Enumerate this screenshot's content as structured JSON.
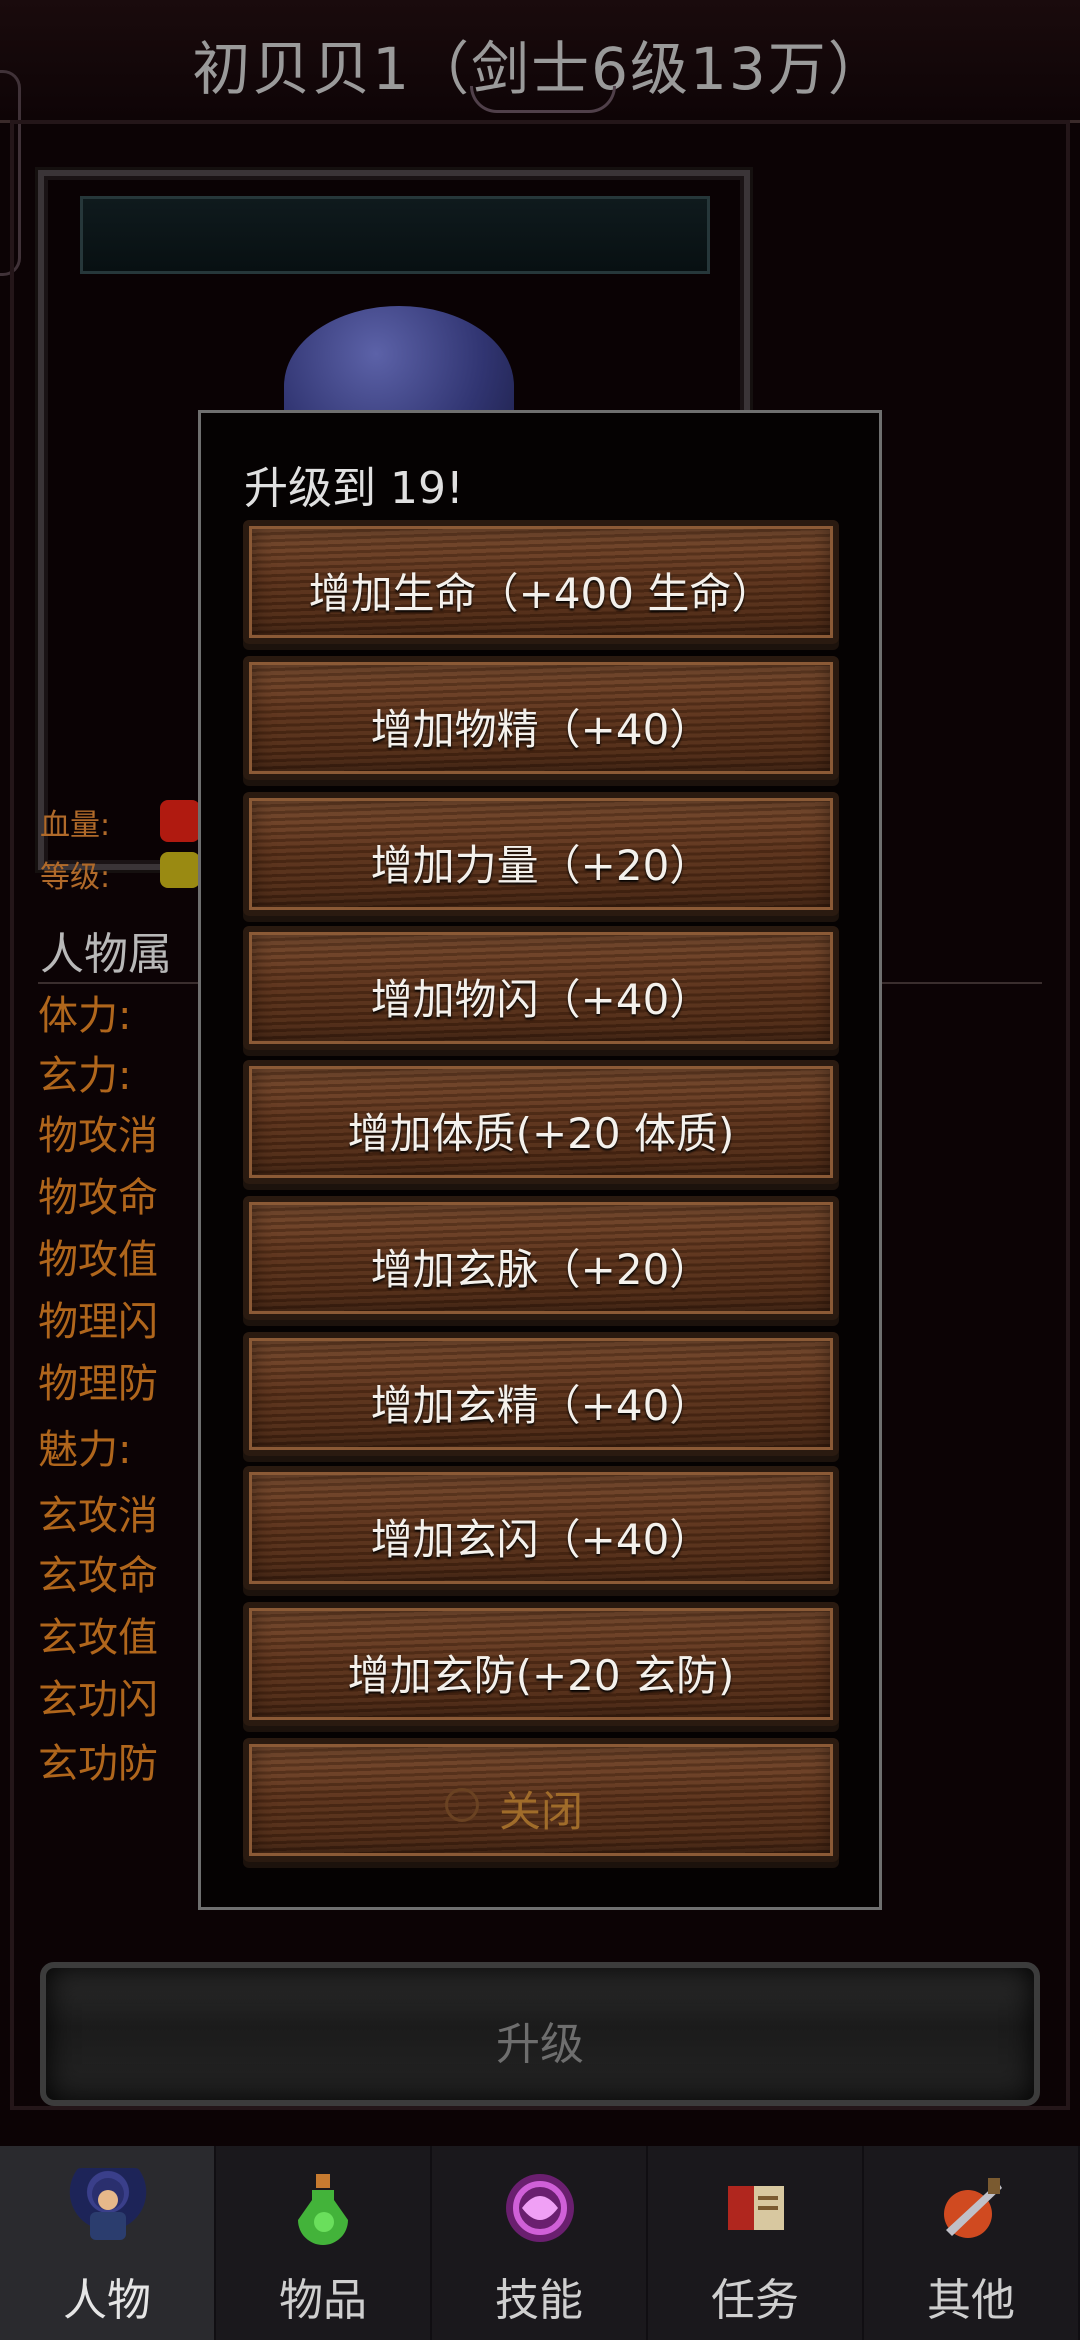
{
  "header": {
    "title": "初贝贝1（剑士6级13万）"
  },
  "stats_bars": {
    "hp_label": "血量:",
    "level_label": "等级:"
  },
  "attributes": {
    "section_title": "人物属",
    "items": [
      "体力:",
      "玄力:",
      "物攻消",
      "物攻命",
      "物攻值",
      "物理闪",
      "物理防",
      "魅力:",
      "玄攻消",
      "玄攻命",
      "玄攻值",
      "玄功闪",
      "玄功防"
    ]
  },
  "upgrade_button": {
    "label": "升级"
  },
  "modal": {
    "title": "升级到 19!",
    "options": [
      {
        "label": "增加生命（+400 生命）"
      },
      {
        "label": "增加物精（+40）"
      },
      {
        "label": "增加力量（+20）"
      },
      {
        "label": "增加物闪（+40）"
      },
      {
        "label": "增加体质(+20 体质)"
      },
      {
        "label": "增加玄脉（+20）"
      },
      {
        "label": "增加玄精（+40）"
      },
      {
        "label": "增加玄闪（+40）"
      },
      {
        "label": "增加玄防(+20 玄防)"
      }
    ],
    "close_label": "关闭"
  },
  "bottom_nav": {
    "active": "人物",
    "tabs": [
      {
        "label": "人物",
        "icon": "character-icon"
      },
      {
        "label": "物品",
        "icon": "potion-icon"
      },
      {
        "label": "技能",
        "icon": "skill-icon"
      },
      {
        "label": "任务",
        "icon": "quest-icon"
      },
      {
        "label": "其他",
        "icon": "other-icon"
      }
    ]
  }
}
